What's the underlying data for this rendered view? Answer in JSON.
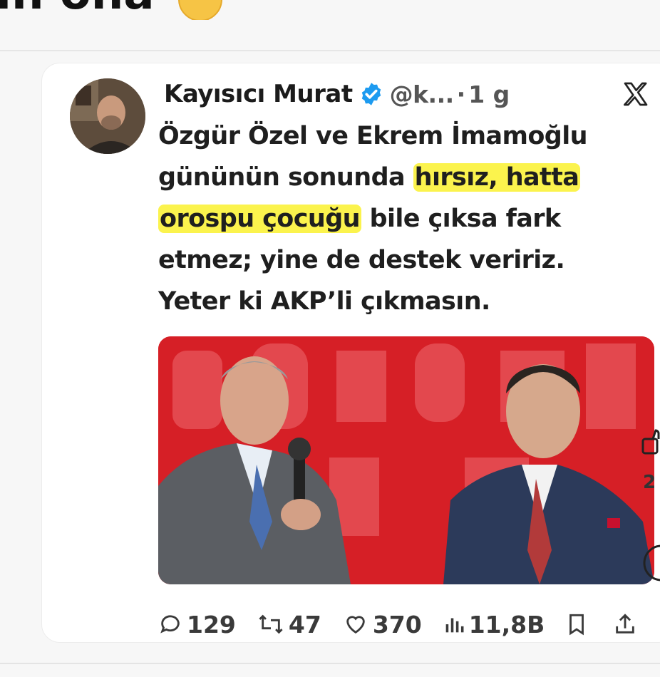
{
  "top": {
    "partial_text": "ın ona"
  },
  "tweet": {
    "author_name": "Kayısıcı Murat",
    "handle": "@k...",
    "separator": "·",
    "time": "1 g",
    "text_lines": [
      [
        "Özgür Özel ve Ekrem ",
        "İmamoğlu"
      ],
      [
        "gününün sonunda ",
        "hırsız, hatta"
      ],
      [
        "orospu çocuğu",
        " bile çıksa fark"
      ],
      [
        "etmez; yine de destek veririz."
      ],
      [
        "Yeter ki AKP’li çıkmasın."
      ]
    ],
    "highlight_color": "#fbf34d"
  },
  "actions": {
    "replies": "129",
    "retweets": "47",
    "likes": "370",
    "views": "11,8B"
  },
  "side": {
    "count_partial": "2"
  },
  "colors": {
    "verified": "#1d9bf0",
    "photo_background": "#d61f26",
    "card": "#ffffff"
  }
}
